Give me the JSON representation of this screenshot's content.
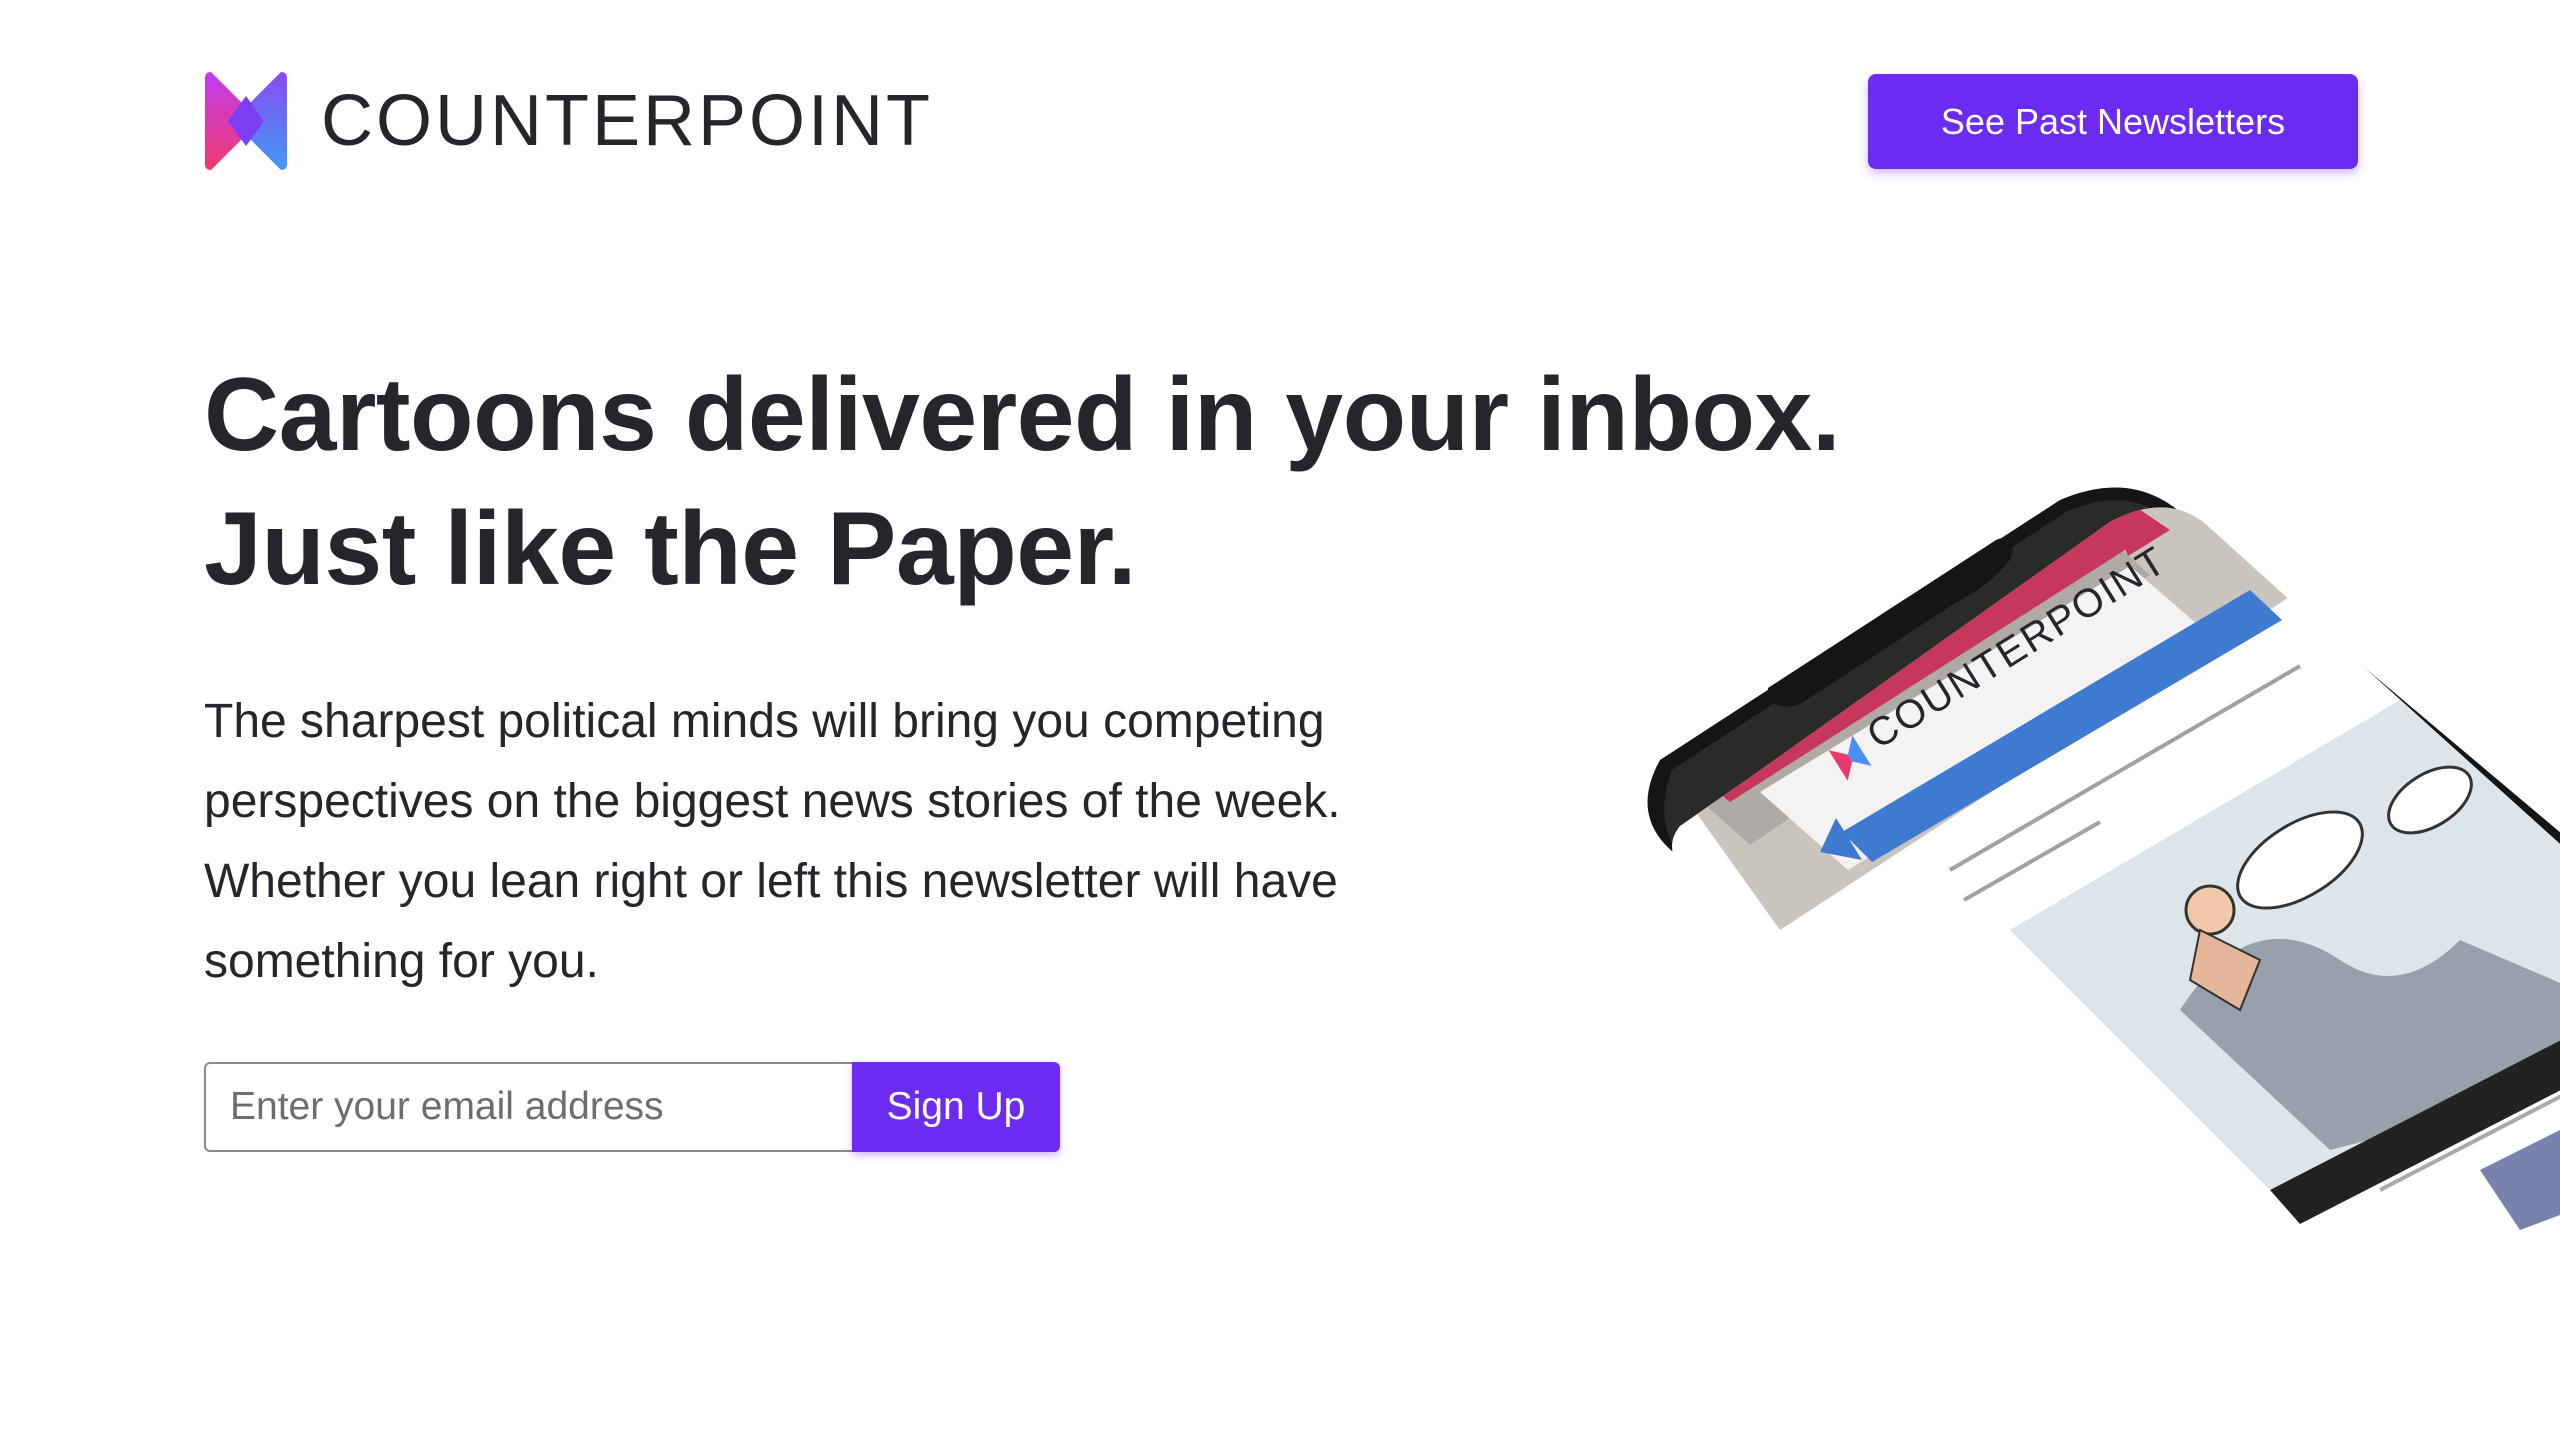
{
  "header": {
    "logo_text": "COUNTERPOINT",
    "past_newsletters_label": "See Past Newsletters"
  },
  "hero": {
    "headline_line1": "Cartoons delivered in your inbox.",
    "headline_line2": "Just like the Paper.",
    "description": "The sharpest political minds will bring you competing perspectives on the biggest news stories of the week. Whether you lean right or left this newsletter will have something for you."
  },
  "signup": {
    "email_placeholder": "Enter your email address",
    "email_value": "",
    "button_label": "Sign Up"
  },
  "phone": {
    "screen_brand": "COUNTERPOINT"
  },
  "colors": {
    "accent": "#6c2bf0",
    "text": "#25262b",
    "logo_pink": "#e8386d",
    "logo_blue": "#4e8ff5",
    "logo_purple": "#7b3ff2"
  }
}
